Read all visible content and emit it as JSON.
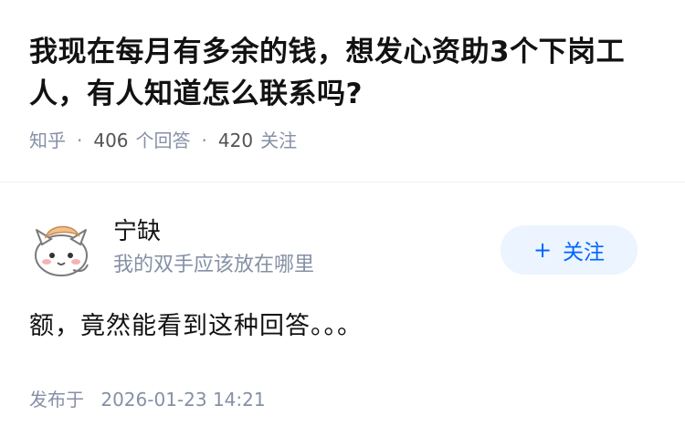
{
  "question": {
    "title": "我现在每月有多余的钱，想发心资助3个下岗工人，有人知道怎么联系吗?",
    "source": "知乎",
    "separator": "·",
    "answer_count": "406",
    "answer_label": "个回答",
    "follower_count": "420",
    "follower_label": "关注"
  },
  "answer": {
    "author_name": "宁缺",
    "author_bio": "我的双手应该放在哪里",
    "follow_plus": "+",
    "follow_label": "关注",
    "content": "额，竟然能看到这种回答。。。",
    "publish_label": "发布于",
    "publish_time": "2026-01-23 14:21"
  },
  "colors": {
    "title": "#121212",
    "meta": "#8590a6",
    "follow_bg": "#ebf4ff",
    "follow_text": "#0066ff"
  },
  "icons": {
    "avatar": "cartoon-cat-avatar"
  }
}
